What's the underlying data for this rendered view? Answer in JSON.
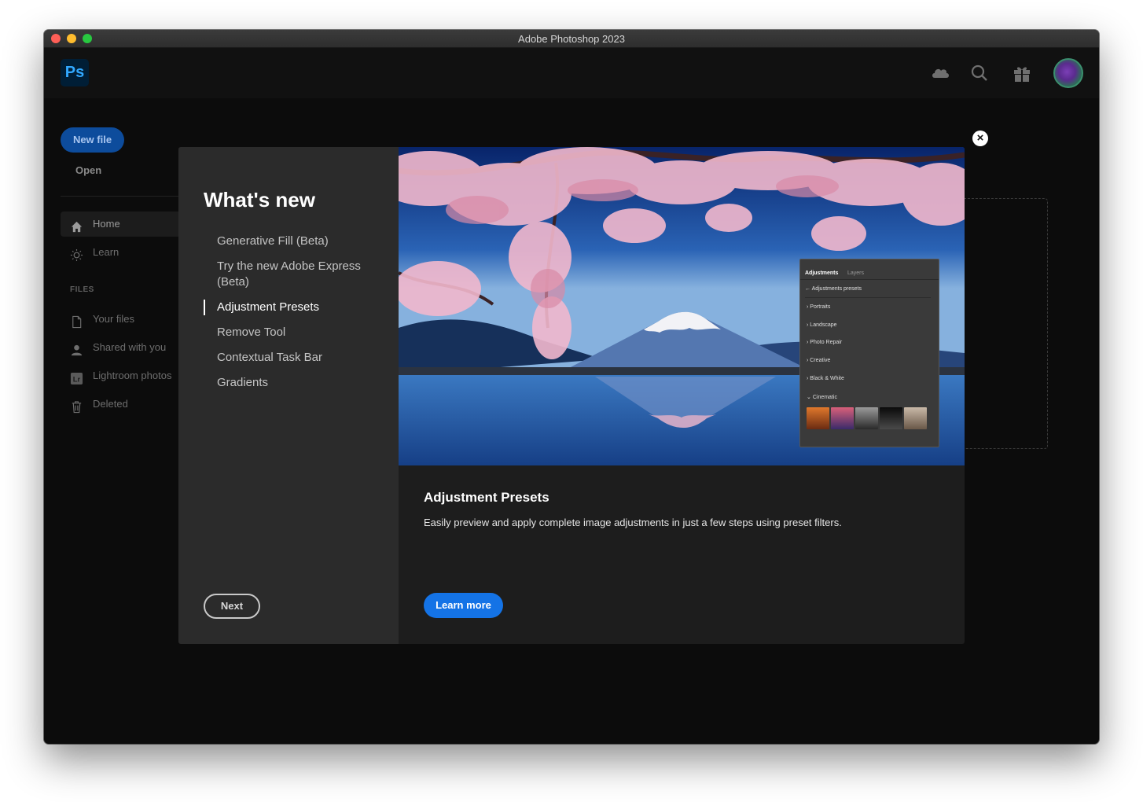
{
  "window": {
    "title": "Adobe Photoshop 2023"
  },
  "app": {
    "logo": "Ps"
  },
  "topbar": {
    "icons": [
      "cloud-icon",
      "search-icon",
      "gift-icon",
      "avatar"
    ]
  },
  "sidebar": {
    "new_file": "New file",
    "open": "Open",
    "nav": [
      {
        "label": "Home",
        "icon": "home-icon",
        "active": true
      },
      {
        "label": "Learn",
        "icon": "lightbulb-icon",
        "active": false
      }
    ],
    "files_header": "FILES",
    "files": [
      {
        "label": "Your files",
        "icon": "file-icon"
      },
      {
        "label": "Shared with you",
        "icon": "person-icon"
      },
      {
        "label": "Lightroom photos",
        "icon": "lightroom-icon"
      },
      {
        "label": "Deleted",
        "icon": "trash-icon"
      }
    ]
  },
  "modal": {
    "heading": "What's new",
    "features": [
      "Generative Fill (Beta)",
      "Try the new Adobe Express (Beta)",
      "Adjustment Presets",
      "Remove Tool",
      "Contextual Task Bar",
      "Gradients"
    ],
    "active_feature_index": 2,
    "next": "Next",
    "panel": {
      "tabs": [
        "Adjustments",
        "Layers"
      ],
      "back_label": "Adjustments presets",
      "rows": [
        "Portraits",
        "Landscape",
        "Photo Repair",
        "Creative",
        "Black & White",
        "Cinematic"
      ]
    },
    "title": "Adjustment Presets",
    "description": "Easily preview and apply complete image adjustments in just a few steps using preset filters.",
    "learn_more": "Learn more",
    "close": "×"
  }
}
